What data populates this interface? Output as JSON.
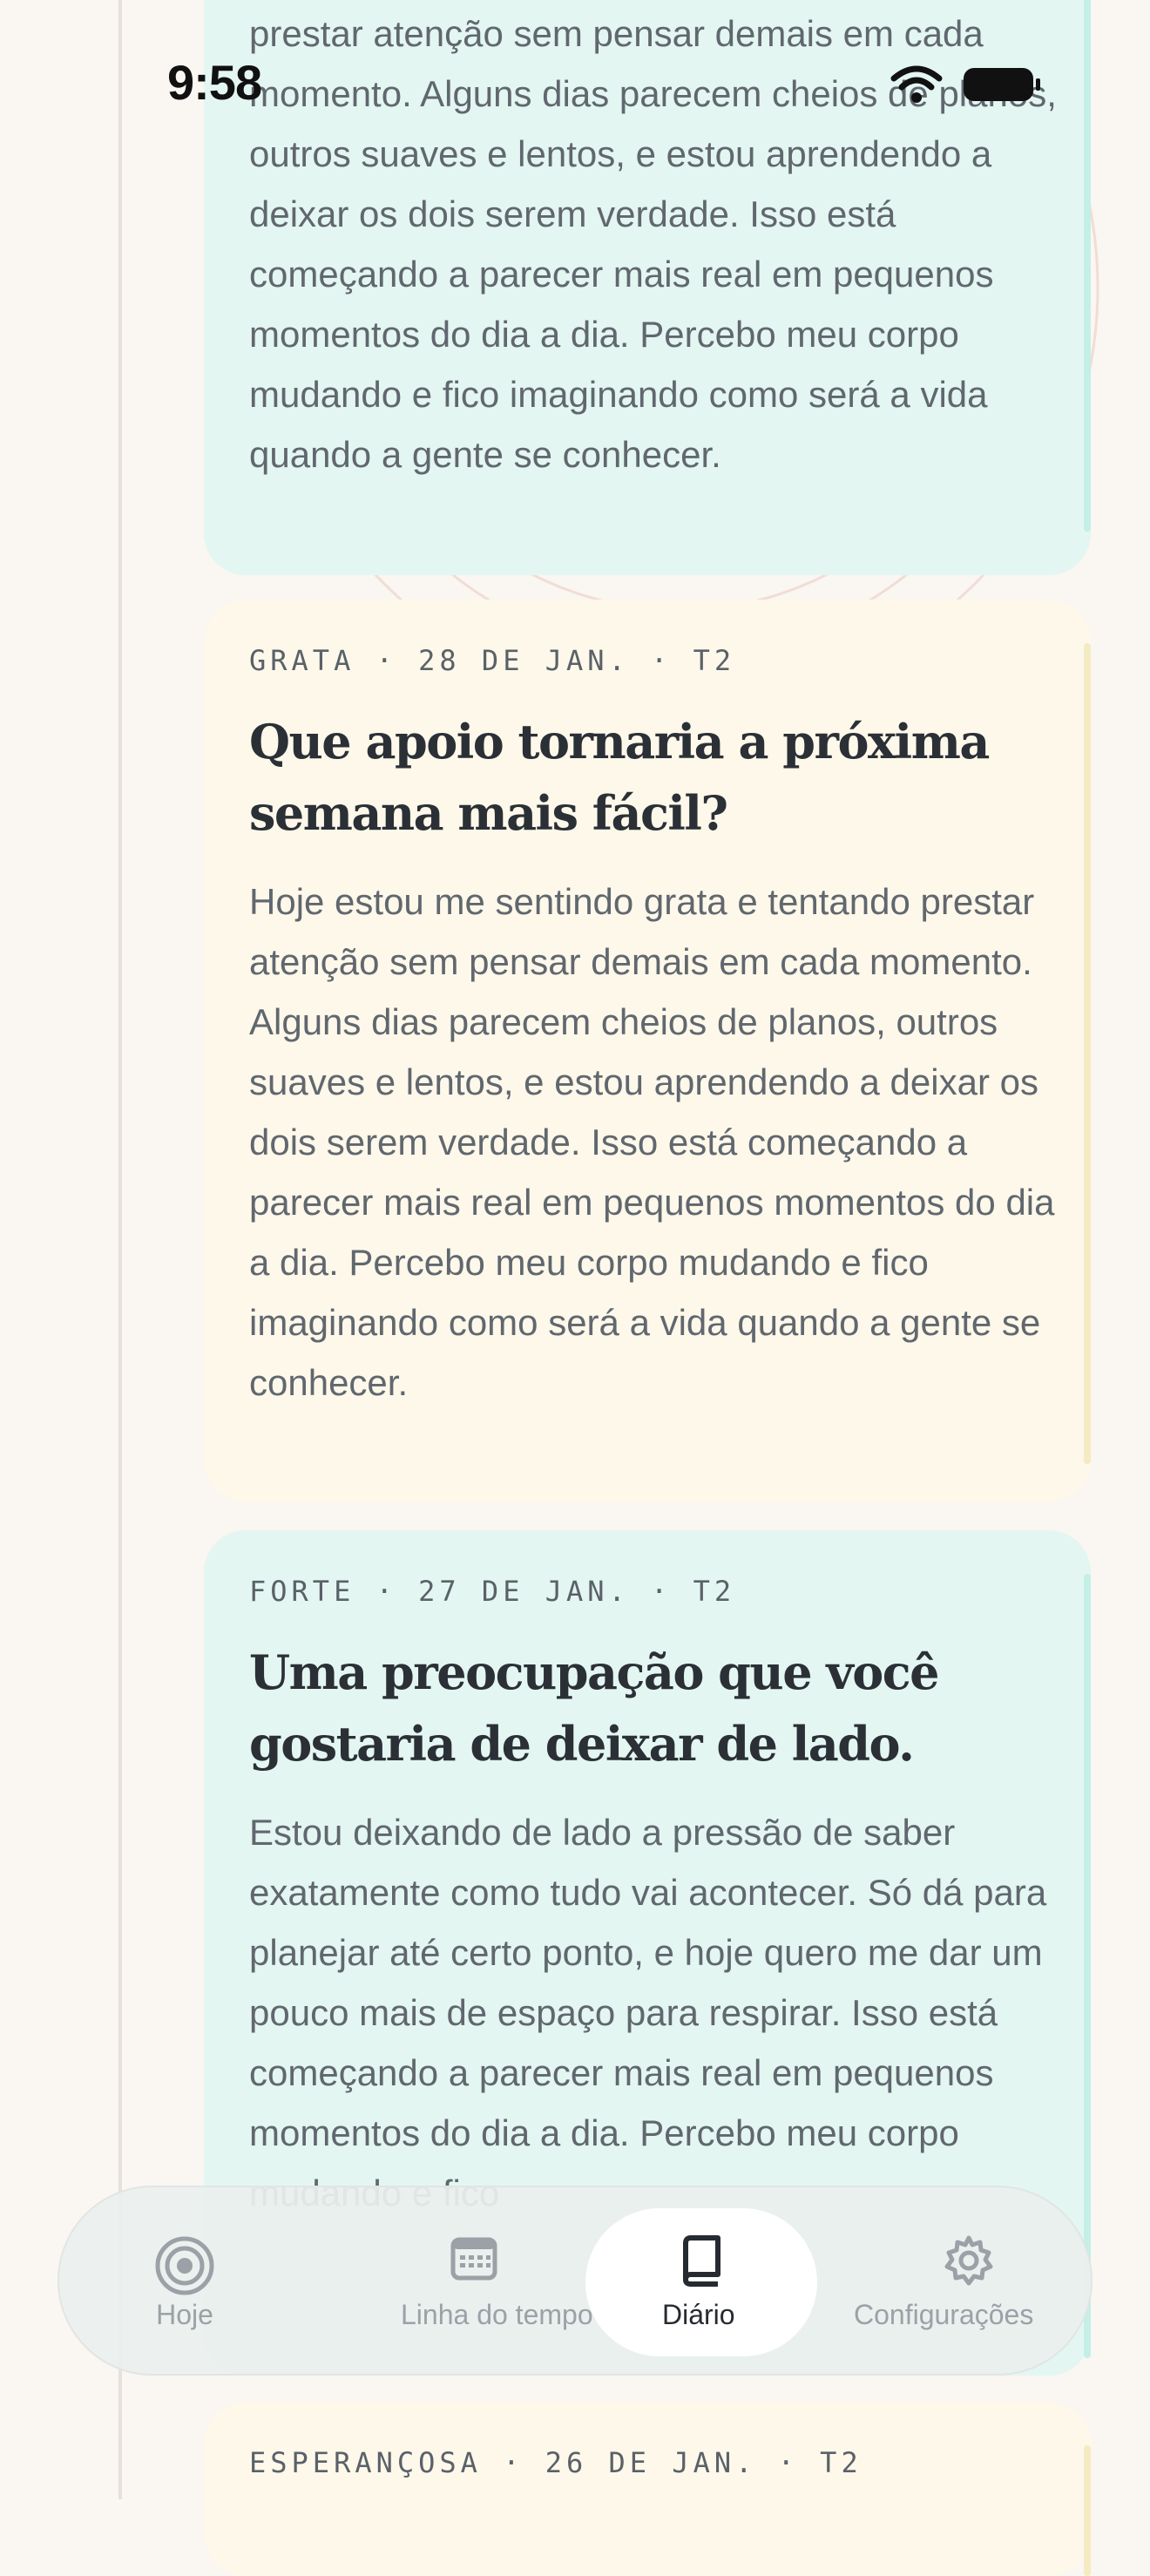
{
  "status_bar": {
    "time": "9:58"
  },
  "entries": [
    {
      "body": "prestar atenção sem pensar demais em cada momento. Alguns dias parecem cheios de planos, outros suaves e lentos, e estou aprendendo a deixar os dois serem verdade. Isso está começando a parecer mais real em pequenos momentos do dia a dia. Percebo meu corpo mudando e fico imaginando como será a vida quando a gente se conhecer."
    },
    {
      "meta": "GRATA · 28 DE JAN. · T2",
      "title": "Que apoio tornaria a próxima semana mais fácil?",
      "body": "Hoje estou me sentindo grata e tentando prestar atenção sem pensar demais em cada momento. Alguns dias parecem cheios de planos, outros suaves e lentos, e estou aprendendo a deixar os dois serem verdade. Isso está começando a parecer mais real em pequenos momentos do dia a dia. Percebo meu corpo mudando e fico imaginando como será a vida quando a gente se conhecer."
    },
    {
      "meta": "FORTE · 27 DE JAN. · T2",
      "title": "Uma preocupação que você gostaria de deixar de lado.",
      "body": "Estou deixando de lado a pressão de saber exatamente como tudo vai acontecer. Só dá para planejar até certo ponto, e hoje quero me dar um pouco mais de espaço para respirar. Isso está começando a parecer mais real em pequenos momentos do dia a dia. Percebo meu corpo mudando e fico"
    },
    {
      "meta": "ESPERANÇOSA · 26 DE JAN. · T2"
    }
  ],
  "tab_bar": {
    "items": [
      {
        "label": "Hoje",
        "icon": "concentric-circles-icon",
        "active": false
      },
      {
        "label": "Linha do tempo",
        "icon": "calendar-icon",
        "active": false
      },
      {
        "label": "Diário",
        "icon": "book-icon",
        "active": true
      },
      {
        "label": "Configurações",
        "icon": "gear-icon",
        "active": false
      }
    ]
  },
  "colors": {
    "background": "#faf6f1",
    "card_mint": "#e3f6f2",
    "card_cream": "#fdf8ea",
    "text_primary": "#2b3036",
    "text_secondary": "#61676e"
  }
}
